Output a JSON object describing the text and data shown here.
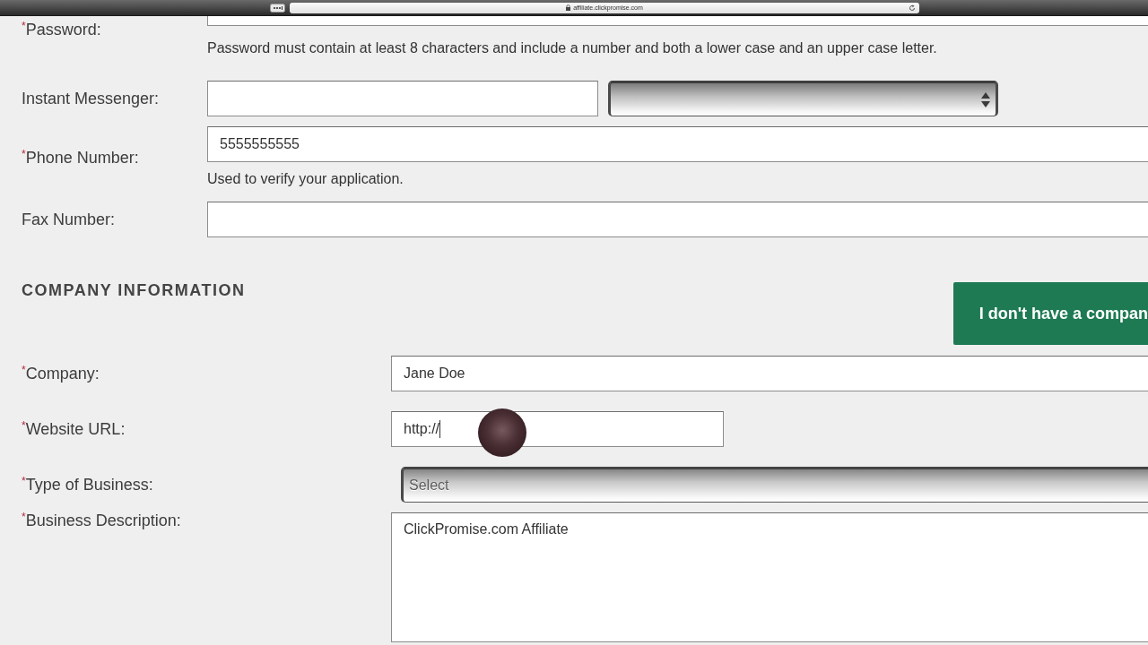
{
  "browser_bar": {
    "url": "affiliate.clickpromise.com"
  },
  "contact_fields": [
    {
      "kind": "password",
      "label": "$^{*}$Password:",
      "hint": "Password must contain at least 8 characters and include a number and both a lower case and an upper case letter."
    },
    {
      "kind": "messenger",
      "label": "Instant Messenger:"
    },
    {
      "kind": "text",
      "label": "$^{*}$Phone Number:",
      "value": "5555555555",
      "hint": "Used to verify your application."
    },
    {
      "kind": "text",
      "label": "Fax Number:"
    }
  ],
  "company_section": {
    "heading": "COMPANY INFORMATION",
    "button": "I don't have a compan"
  },
  "company_fields": [
    {
      "kind": "text",
      "label": "$^{*}$Company:",
      "value": "Jane Doe"
    },
    {
      "kind": "url",
      "label": "$^{*}$Website URL:",
      "value": "http://",
      "focused": true,
      "clicked": true
    },
    {
      "kind": "select",
      "label": "$^{*}$Type of Business:",
      "value": "Select"
    },
    {
      "kind": "textarea",
      "label": "$^{*}$Business Description:",
      "value": "ClickPromise.com Affiliate"
    }
  ]
}
